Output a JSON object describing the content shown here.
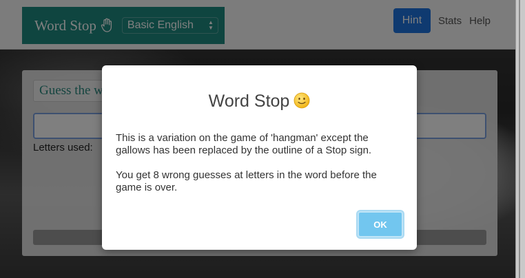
{
  "navbar": {
    "brand_title": "Word Stop",
    "brand_icon": "hand-stop-icon",
    "language_select": {
      "selected": "Basic English",
      "icon": "select-arrows-icon"
    },
    "hint_label": "Hint",
    "stats_label": "Stats",
    "help_label": "Help"
  },
  "game": {
    "guess_label": "Guess the word",
    "input_value": "",
    "letters_used_label": "Letters used:"
  },
  "modal": {
    "title": "Word Stop",
    "title_icon": "smiley-icon",
    "paragraph1": "This is a variation on the game of 'hangman' except the gallows has been replaced by the outline of a Stop sign.",
    "paragraph2": "You get 8 wrong guesses at letters in the word before the game is over.",
    "ok_label": "OK"
  },
  "colors": {
    "brand": "#1f8a80",
    "hint_button": "#1f74e0",
    "ok_button": "#72c6ef"
  }
}
